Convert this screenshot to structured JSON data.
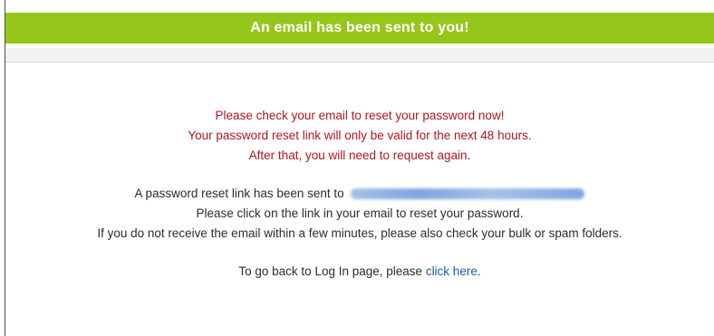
{
  "header": {
    "title": "An email has been sent to you!"
  },
  "warning": {
    "line1": "Please check your email to reset your password now!",
    "line2": "Your password reset link will only be valid for the next 48 hours.",
    "line3": "After that, you will need to request again."
  },
  "info": {
    "sent_prefix": "A password reset link has been sent to",
    "line2": "Please click on the link in your email to reset your password.",
    "line3": "If you do not receive the email within a few minutes, please also check your bulk or spam folders."
  },
  "back": {
    "prefix": "To go back to Log In page, please",
    "link_label": "click here",
    "suffix": "."
  },
  "colors": {
    "header_bg": "#97c61b",
    "warning_text": "#b3161c",
    "link": "#1a59b8"
  }
}
